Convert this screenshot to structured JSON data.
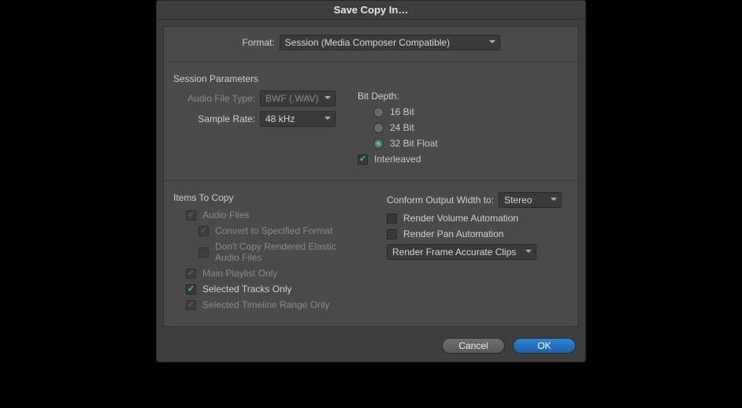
{
  "title": "Save Copy In…",
  "format": {
    "label": "Format:",
    "value": "Session (Media Composer Compatible)"
  },
  "session": {
    "title": "Session Parameters",
    "audioFileType": {
      "label": "Audio File Type:",
      "value": "BWF (.WAV)"
    },
    "sampleRate": {
      "label": "Sample Rate:",
      "value": "48 kHz"
    },
    "bitDepth": {
      "label": "Bit Depth:",
      "options": [
        "16 Bit",
        "24 Bit",
        "32 Bit Float"
      ],
      "selected": "32 Bit Float"
    },
    "interleaved": {
      "label": "Interleaved",
      "checked": true
    }
  },
  "items": {
    "title": "Items To Copy",
    "audioFiles": {
      "label": "Audio Files",
      "checked": true,
      "dim": true
    },
    "convert": {
      "label": "Convert to Specified Format",
      "checked": true,
      "dim": true
    },
    "dontCopyElastic": {
      "label": "Don't Copy Rendered Elastic Audio Files",
      "checked": false,
      "dim": true
    },
    "mainPlaylist": {
      "label": "Main Playlist Only",
      "checked": true,
      "dim": true
    },
    "selectedTracks": {
      "label": "Selected Tracks Only",
      "checked": true,
      "dim": false
    },
    "selectedTimeline": {
      "label": "Selected Timeline Range Only",
      "checked": true,
      "dim": true
    }
  },
  "conform": {
    "label": "Conform Output Width to:",
    "value": "Stereo",
    "renderVolume": {
      "label": "Render Volume Automation",
      "checked": false
    },
    "renderPan": {
      "label": "Render Pan Automation",
      "checked": false
    },
    "renderFrame": {
      "value": "Render Frame Accurate Clips"
    }
  },
  "buttons": {
    "cancel": "Cancel",
    "ok": "OK"
  }
}
